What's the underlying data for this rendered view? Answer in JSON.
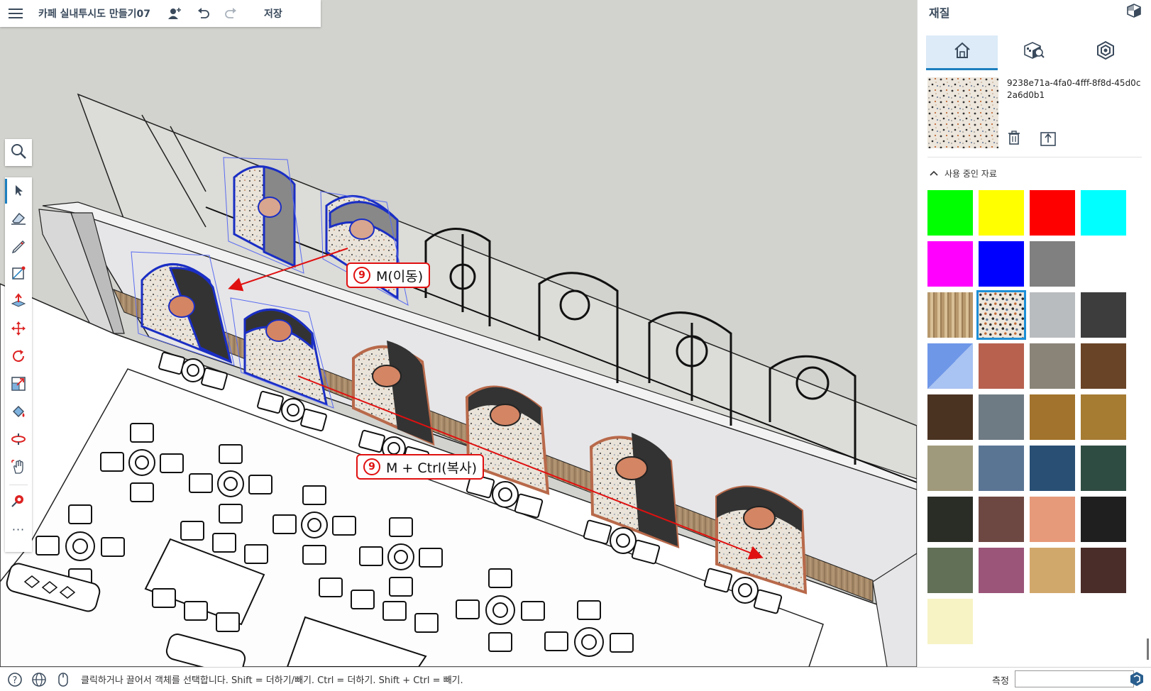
{
  "app": {
    "document_title": "카페 실내투시도 만들기07",
    "save_label": "저장"
  },
  "toolbar_icons": [
    "hamburger-menu-icon",
    "add-user-icon",
    "undo-icon",
    "redo-icon"
  ],
  "left_tools": [
    "search-icon",
    "select-arrow-icon",
    "eraser-icon",
    "pencil-icon",
    "rectangle-icon",
    "push-pull-icon",
    "move-icon",
    "rotate-icon",
    "scale-icon",
    "paint-bucket-icon",
    "orbit-icon",
    "pan-icon",
    "section-icon",
    "more-icon"
  ],
  "annotations": {
    "move": {
      "number": "9",
      "text": "M(이동)"
    },
    "copy": {
      "number": "9",
      "text": "M + Ctrl(복사)"
    }
  },
  "panel": {
    "title": "재질",
    "material_name": "9238e71a-4fa0-4fff-8f8d-45d0c2a6d0b1",
    "in_use_label": "사용 중인 자료",
    "swatches": [
      {
        "color": "#00ff00"
      },
      {
        "color": "#ffff00"
      },
      {
        "color": "#ff0000"
      },
      {
        "color": "#00ffff"
      },
      {
        "color": "#ff00ff"
      },
      {
        "color": "#0000ff"
      },
      {
        "color": "#808080"
      },
      {
        "color": "#ffffff"
      },
      {
        "color": "#c8a878",
        "pattern": "wood"
      },
      {
        "color": "#ede6dc",
        "pattern": "terrazzo",
        "selected": true
      },
      {
        "color": "#b9bcbe"
      },
      {
        "color": "#3d3d3d"
      },
      {
        "color": "#6f97e8",
        "pattern": "diagonal"
      },
      {
        "color": "#b8614f"
      },
      {
        "color": "#8a8478"
      },
      {
        "color": "#6a4427"
      },
      {
        "color": "#4b3322"
      },
      {
        "color": "#6f7b84"
      },
      {
        "color": "#a2732c"
      },
      {
        "color": "#a67c33"
      },
      {
        "color": "#a09a7c"
      },
      {
        "color": "#5a7594"
      },
      {
        "color": "#294f74"
      },
      {
        "color": "#2f4c43"
      },
      {
        "color": "#2a2d26"
      },
      {
        "color": "#6d4842"
      },
      {
        "color": "#e69a7a"
      },
      {
        "color": "#1f1f1f"
      },
      {
        "color": "#627058"
      },
      {
        "color": "#9a5579"
      },
      {
        "color": "#d1a86c"
      },
      {
        "color": "#4a2d28"
      },
      {
        "color": "#f7f3c4"
      }
    ]
  },
  "status": {
    "hint": "클릭하거나 끌어서 객체를 선택합니다. Shift = 더하기/빼기. Ctrl = 더하기. Shift + Ctrl = 빼기.",
    "measure_label": "측정",
    "measure_value": ""
  }
}
